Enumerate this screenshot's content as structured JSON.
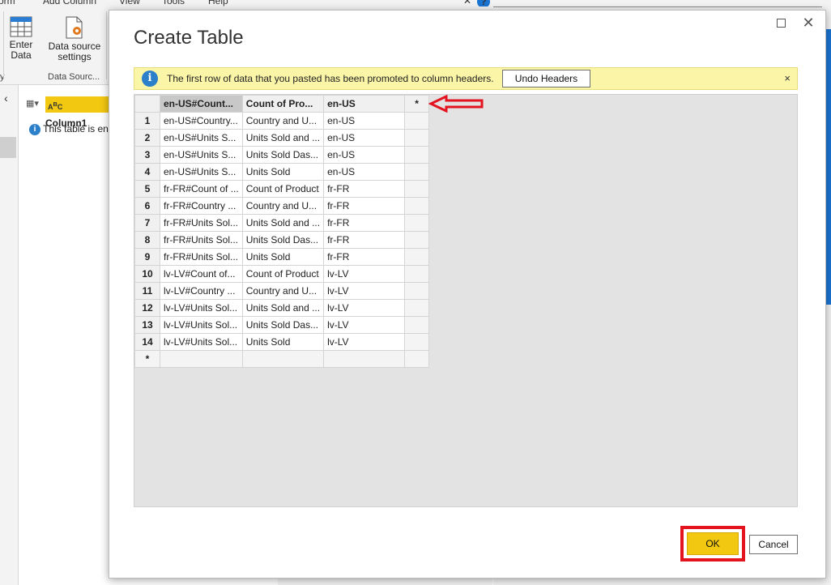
{
  "background": {
    "menubar": [
      "orm",
      "Add Column",
      "View",
      "Tools",
      "Help"
    ],
    "ribbon": {
      "enter_data_label": "Enter\nData",
      "data_source_settings_label": "Data source\nsettings",
      "group_label": "Data Sourc...",
      "left_group_label": "y"
    },
    "query_column_label": "Column1",
    "info_text": "This table is en"
  },
  "dialog": {
    "title": "Create Table",
    "info_bar": {
      "text": "The first row of data that you pasted has been promoted to column headers.",
      "undo_button": "Undo Headers",
      "close_glyph": "×"
    },
    "table": {
      "columns": [
        "en-US#Count...",
        "Count of Pro...",
        "en-US",
        "*"
      ],
      "rows": [
        {
          "n": "1",
          "c1": "en-US#Country...",
          "c2": "Country and U...",
          "c3": "en-US"
        },
        {
          "n": "2",
          "c1": "en-US#Units S...",
          "c2": "Units Sold and ...",
          "c3": "en-US"
        },
        {
          "n": "3",
          "c1": "en-US#Units S...",
          "c2": "Units Sold Das...",
          "c3": "en-US"
        },
        {
          "n": "4",
          "c1": "en-US#Units S...",
          "c2": "Units Sold",
          "c3": "en-US"
        },
        {
          "n": "5",
          "c1": "fr-FR#Count of ...",
          "c2": "Count of Product",
          "c3": "fr-FR"
        },
        {
          "n": "6",
          "c1": "fr-FR#Country ...",
          "c2": "Country and U...",
          "c3": "fr-FR"
        },
        {
          "n": "7",
          "c1": "fr-FR#Units Sol...",
          "c2": "Units Sold and ...",
          "c3": "fr-FR"
        },
        {
          "n": "8",
          "c1": "fr-FR#Units Sol...",
          "c2": "Units Sold Das...",
          "c3": "fr-FR"
        },
        {
          "n": "9",
          "c1": "fr-FR#Units Sol...",
          "c2": "Units Sold",
          "c3": "fr-FR"
        },
        {
          "n": "10",
          "c1": "lv-LV#Count of...",
          "c2": "Count of Product",
          "c3": "lv-LV"
        },
        {
          "n": "11",
          "c1": "lv-LV#Country ...",
          "c2": "Country and U...",
          "c3": "lv-LV"
        },
        {
          "n": "12",
          "c1": "lv-LV#Units Sol...",
          "c2": "Units Sold and ...",
          "c3": "lv-LV"
        },
        {
          "n": "13",
          "c1": "lv-LV#Units Sol...",
          "c2": "Units Sold Das...",
          "c3": "lv-LV"
        },
        {
          "n": "14",
          "c1": "lv-LV#Units Sol...",
          "c2": "Units Sold",
          "c3": "lv-LV"
        }
      ],
      "new_row_marker": "*"
    },
    "buttons": {
      "ok": "OK",
      "cancel": "Cancel"
    }
  },
  "colors": {
    "accent_yellow": "#f2c811",
    "annotation_red": "#e3141f",
    "info_bar_bg": "#fbf5a8",
    "info_icon_blue": "#2c7fc9"
  }
}
